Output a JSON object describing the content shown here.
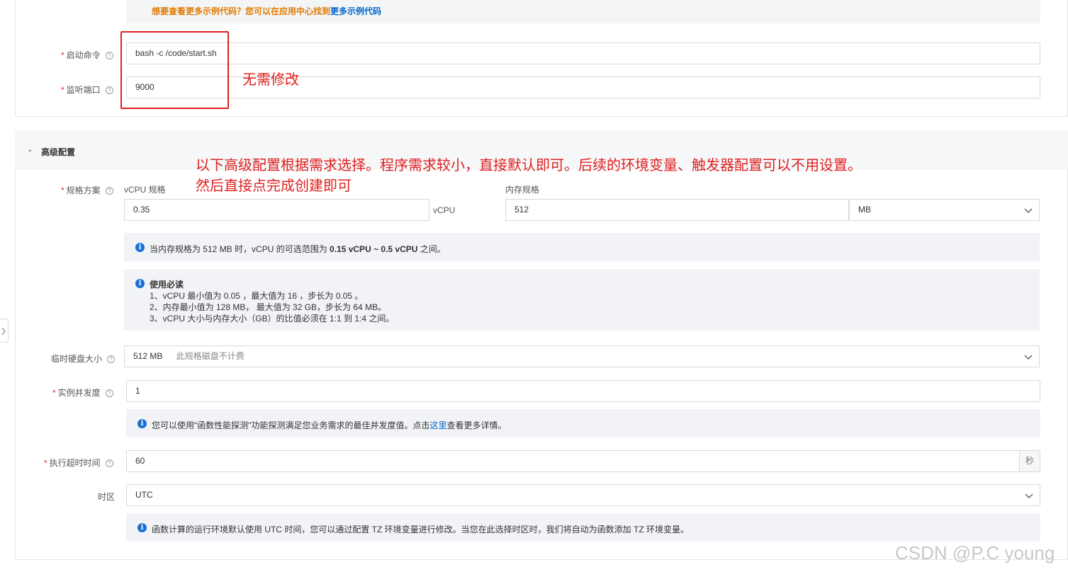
{
  "top": {
    "hint_text": "想要查看更多示例代码？您可以在应用中心找到",
    "hint_link": "更多示例代码",
    "start_cmd_label": "启动命令",
    "start_cmd_value": "bash -c /code/start.sh",
    "port_label": "监听端口",
    "port_value": "9000"
  },
  "annotations": {
    "no_change": "无需修改",
    "advanced_note_line1": "以下高级配置根据需求选择。程序需求较小，直接默认即可。后续的环境变量、触发器配置可以不用设置。",
    "advanced_note_line2": "然后直接点完成创建即可"
  },
  "advanced": {
    "title": "高级配置",
    "spec_label": "规格方案",
    "vcpu_label": "vCPU 规格",
    "vcpu_value": "0.35",
    "vcpu_unit": "vCPU",
    "mem_label": "内存规格",
    "mem_value": "512",
    "mem_unit": "MB",
    "range_info_prefix": "当内存规格为 512 MB 时，vCPU 的可选范围为 ",
    "range_info_bold": "0.15 vCPU ~ 0.5 vCPU",
    "range_info_suffix": " 之间。",
    "must_read_title": "使用必读",
    "must_read_1": "1、vCPU 最小值为 0.05 ，最大值为 16 ，步长为 0.05 。",
    "must_read_2": "2、内存最小值为 128 MB， 最大值为 32 GB，步长为 64 MB。",
    "must_read_3": "3、vCPU 大小与内存大小（GB）的比值必须在 1:1 到 1:4 之间。",
    "disk_label": "临时硬盘大小",
    "disk_value": "512 MB",
    "disk_note": "此规格磁盘不计费",
    "concurrency_label": "实例并发度",
    "concurrency_value": "1",
    "concurrency_info_prefix": "您可以使用\"函数性能探测\"功能探测满足您业务需求的最佳并发度值。点击",
    "concurrency_info_link": "这里",
    "concurrency_info_suffix": "查看更多详情。",
    "timeout_label": "执行超时时间",
    "timeout_value": "60",
    "timeout_unit": "秒",
    "tz_label": "时区",
    "tz_value": "UTC",
    "tz_info": "函数计算的运行环境默认使用 UTC 时间，您可以通过配置 TZ 环境变量进行修改。当您在此选择时区时，我们将自动为函数添加 TZ 环境变量。"
  },
  "watermark": "CSDN @P.C young",
  "colors": {
    "annotation_red": "#e0201e",
    "info_blue": "#1a6fd4",
    "hint_orange": "#e07a00",
    "link_blue": "#0066cc"
  }
}
